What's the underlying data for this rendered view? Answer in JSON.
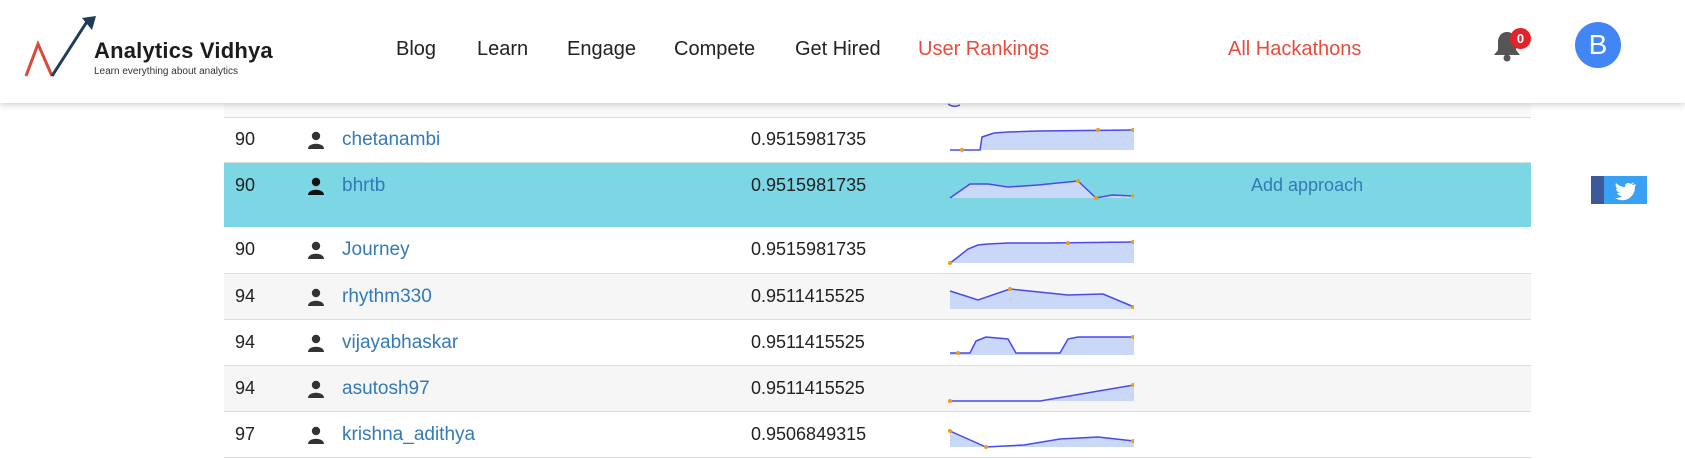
{
  "header": {
    "logo_name": "Analytics Vidhya",
    "logo_tagline": "Learn everything about analytics",
    "nav": [
      "Blog",
      "Learn",
      "Engage",
      "Compete",
      "Get Hired",
      "User Rankings",
      "All Hackathons"
    ],
    "notification_count": "0",
    "avatar_initial": "B"
  },
  "colors": {
    "accent_red": "#e74c3c",
    "link_blue": "#337ab7",
    "highlight_row": "#7dd6e4",
    "avatar": "#4285f4"
  },
  "leaderboard": {
    "rows": [
      {
        "rank": "90",
        "user": "chetanambi",
        "score": "0.9515981735",
        "approach": ""
      },
      {
        "rank": "90",
        "user": "bhrtb",
        "score": "0.9515981735",
        "approach": "Add approach"
      },
      {
        "rank": "90",
        "user": "Journey",
        "score": "0.9515981735",
        "approach": ""
      },
      {
        "rank": "94",
        "user": "rhythm330",
        "score": "0.9511415525",
        "approach": ""
      },
      {
        "rank": "94",
        "user": "vijayabhaskar",
        "score": "0.9511415525",
        "approach": ""
      },
      {
        "rank": "94",
        "user": "asutosh97",
        "score": "0.9511415525",
        "approach": ""
      },
      {
        "rank": "97",
        "user": "krishna_adithya",
        "score": "0.9506849315",
        "approach": ""
      }
    ]
  },
  "share": {
    "icons": [
      "facebook-icon",
      "twitter-icon"
    ]
  }
}
